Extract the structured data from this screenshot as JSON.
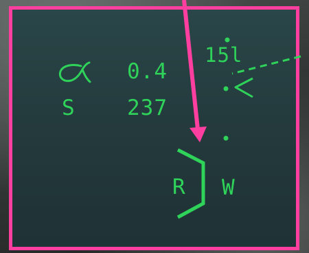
{
  "hud": {
    "alpha_symbol": "α",
    "alpha_value": "0.4",
    "speed_label": "S",
    "speed_value": "237",
    "heading_value": "15l",
    "hexagon_label": "R",
    "side_label": "W"
  },
  "colors": {
    "hud_green": "#2fd35a",
    "annotation_pink": "#ff3fa0",
    "panel_teal": "#23393c"
  },
  "icons": {
    "alpha": "alpha-icon",
    "chevron": "chevron-left-icon",
    "hexagon": "hexagon-bracket-icon",
    "arrow": "down-arrow-icon"
  }
}
